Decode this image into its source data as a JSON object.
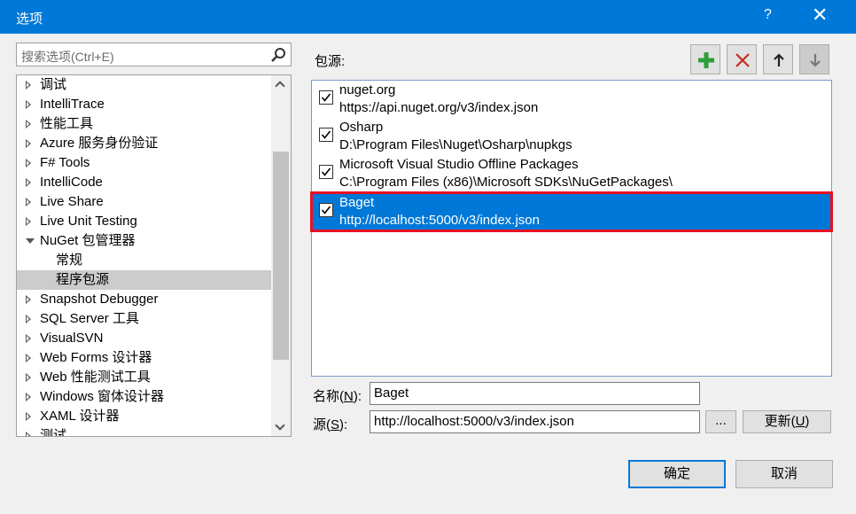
{
  "window": {
    "title": "选项",
    "help_label": "?",
    "close_label": "✕"
  },
  "search": {
    "placeholder": "搜索选项(Ctrl+E)",
    "icon": "search-icon"
  },
  "tree": {
    "items": [
      {
        "label": "调试",
        "expanded": false
      },
      {
        "label": "IntelliTrace",
        "expanded": false
      },
      {
        "label": "性能工具",
        "expanded": false
      },
      {
        "label": "Azure 服务身份验证",
        "expanded": false
      },
      {
        "label": "F# Tools",
        "expanded": false
      },
      {
        "label": "IntelliCode",
        "expanded": false
      },
      {
        "label": "Live Share",
        "expanded": false
      },
      {
        "label": "Live Unit Testing",
        "expanded": false
      },
      {
        "label": "NuGet 包管理器",
        "expanded": true
      },
      {
        "label": "常规",
        "child": true
      },
      {
        "label": "程序包源",
        "child": true,
        "selected": true
      },
      {
        "label": "Snapshot Debugger",
        "expanded": false
      },
      {
        "label": "SQL Server 工具",
        "expanded": false
      },
      {
        "label": "VisualSVN",
        "expanded": false
      },
      {
        "label": "Web Forms 设计器",
        "expanded": false
      },
      {
        "label": "Web 性能测试工具",
        "expanded": false
      },
      {
        "label": "Windows 窗体设计器",
        "expanded": false
      },
      {
        "label": "XAML 设计器",
        "expanded": false
      },
      {
        "label": "测试",
        "expanded": false
      }
    ]
  },
  "sources_label": "包源:",
  "toolbar": {
    "add_icon": "plus-icon",
    "remove_icon": "delete-icon",
    "up_icon": "arrow-up-icon",
    "down_icon": "arrow-down-icon"
  },
  "sources": [
    {
      "name": "nuget.org",
      "url": "https://api.nuget.org/v3/index.json",
      "checked": true,
      "selected": false
    },
    {
      "name": "Osharp",
      "url": "D:\\Program Files\\Nuget\\Osharp\\nupkgs",
      "checked": true,
      "selected": false
    },
    {
      "name": "Microsoft Visual Studio Offline Packages",
      "url": "C:\\Program Files (x86)\\Microsoft SDKs\\NuGetPackages\\",
      "checked": true,
      "selected": false
    },
    {
      "name": "Baget",
      "url": "http://localhost:5000/v3/index.json",
      "checked": true,
      "selected": true
    }
  ],
  "form": {
    "name_label_pre": "名称(",
    "name_label_key": "N",
    "name_label_post": "):",
    "name_value": "Baget",
    "source_label_pre": "源(",
    "source_label_key": "S",
    "source_label_post": "):",
    "source_value": "http://localhost:5000/v3/index.json",
    "browse_label": "...",
    "update_label_pre": "更新(",
    "update_label_key": "U",
    "update_label_post": ")"
  },
  "buttons": {
    "ok_label": "确定",
    "cancel_label": "取消"
  },
  "colors": {
    "accent": "#0078d7",
    "highlight_border": "#e81123",
    "add_green": "#2e9e3a",
    "remove_red": "#c42b1c"
  }
}
